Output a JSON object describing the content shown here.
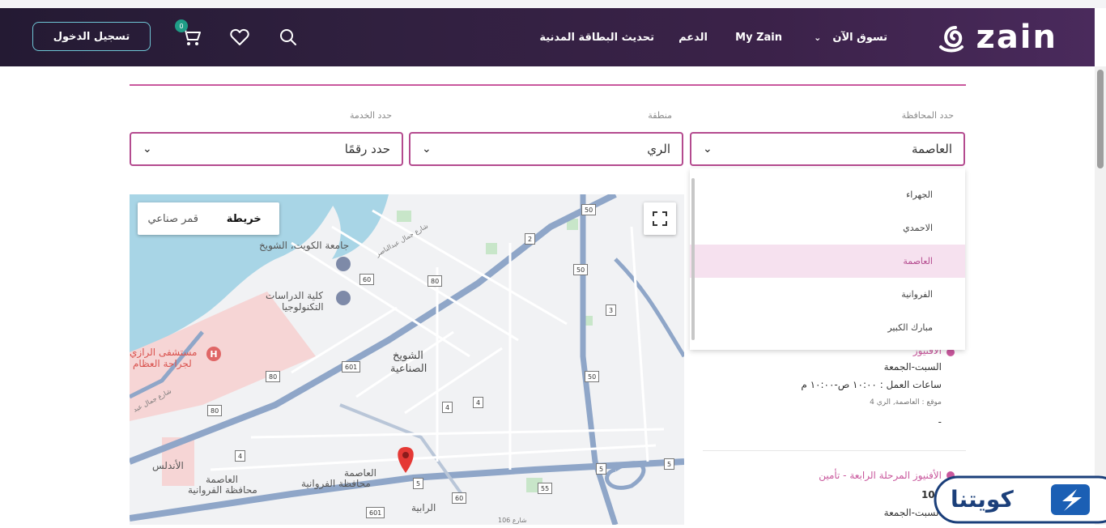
{
  "header": {
    "logo_text": "zain",
    "nav": {
      "shop_now": "تسوق الآن",
      "my_zain": "My Zain",
      "support": "الدعم",
      "civil_id_update": "تحديث البطاقة المدنية"
    },
    "login_label": "تسجيل الدخول",
    "cart_count": "0"
  },
  "filters": {
    "governorate_label": "حدد المحافظة",
    "governorate_value": "العاصمة",
    "area_label": "منطقة",
    "area_value": "الري",
    "service_label": "حدد الخدمة",
    "service_value": "حدد رقمًا"
  },
  "governorate_options": [
    {
      "label": "الجهراء",
      "selected": false
    },
    {
      "label": "الاحمدي",
      "selected": false
    },
    {
      "label": "العاصمة",
      "selected": true
    },
    {
      "label": "الفروانية",
      "selected": false
    },
    {
      "label": "مبارك الكبير",
      "selected": false
    }
  ],
  "map": {
    "toggle_map": "خريطة",
    "toggle_satellite": "قمر صناعي",
    "labels": {
      "kuwait_univ": "جامعة الكويت، الشويخ",
      "tech_college_1": "كلية الدراسات",
      "tech_college_2": "التكنولوجيا",
      "hospital_1": "مستشفى الرازي",
      "hospital_2": "لجراحة العظام",
      "shuwaikh_1": "الشويخ",
      "shuwaikh_2": "الصناعية",
      "asima_1": "العاصمة",
      "asima_2": "محافظة الفروانية",
      "asima_3": "العاصمة",
      "asima_4": "محافظة الفروانية",
      "andalus": "الأندلس",
      "rabiya": "الرابية",
      "street_abdulnasser": "شارع جمال عبدالناصر",
      "street_106": "شارع 106",
      "street_jamal": "شارع جمال عبد"
    },
    "road_shields": [
      "50",
      "2",
      "50",
      "3",
      "60",
      "80",
      "601",
      "80",
      "80",
      "4",
      "4",
      "50",
      "4",
      "5",
      "5",
      "55",
      "60",
      "601",
      "5"
    ]
  },
  "results": [
    {
      "title": "الأفنيوز",
      "days": "السبت-الجمعة",
      "hours": "ساعات العمل : ١٠:٠٠ ص-١٠:٠٠ م",
      "location": "موقع : العاصمة, الري 4",
      "extra": "-"
    },
    {
      "title": "الأفنيوز المرحلة الرابعة - تأمين",
      "number": "107",
      "days": "السبت-الجمعة"
    }
  ],
  "badge_text": "كويتنا",
  "colors": {
    "accent": "#b44b8f",
    "header_dark": "#2a1d38",
    "login_border": "#6fc6d6",
    "badge_blue": "#1b5fb4"
  }
}
